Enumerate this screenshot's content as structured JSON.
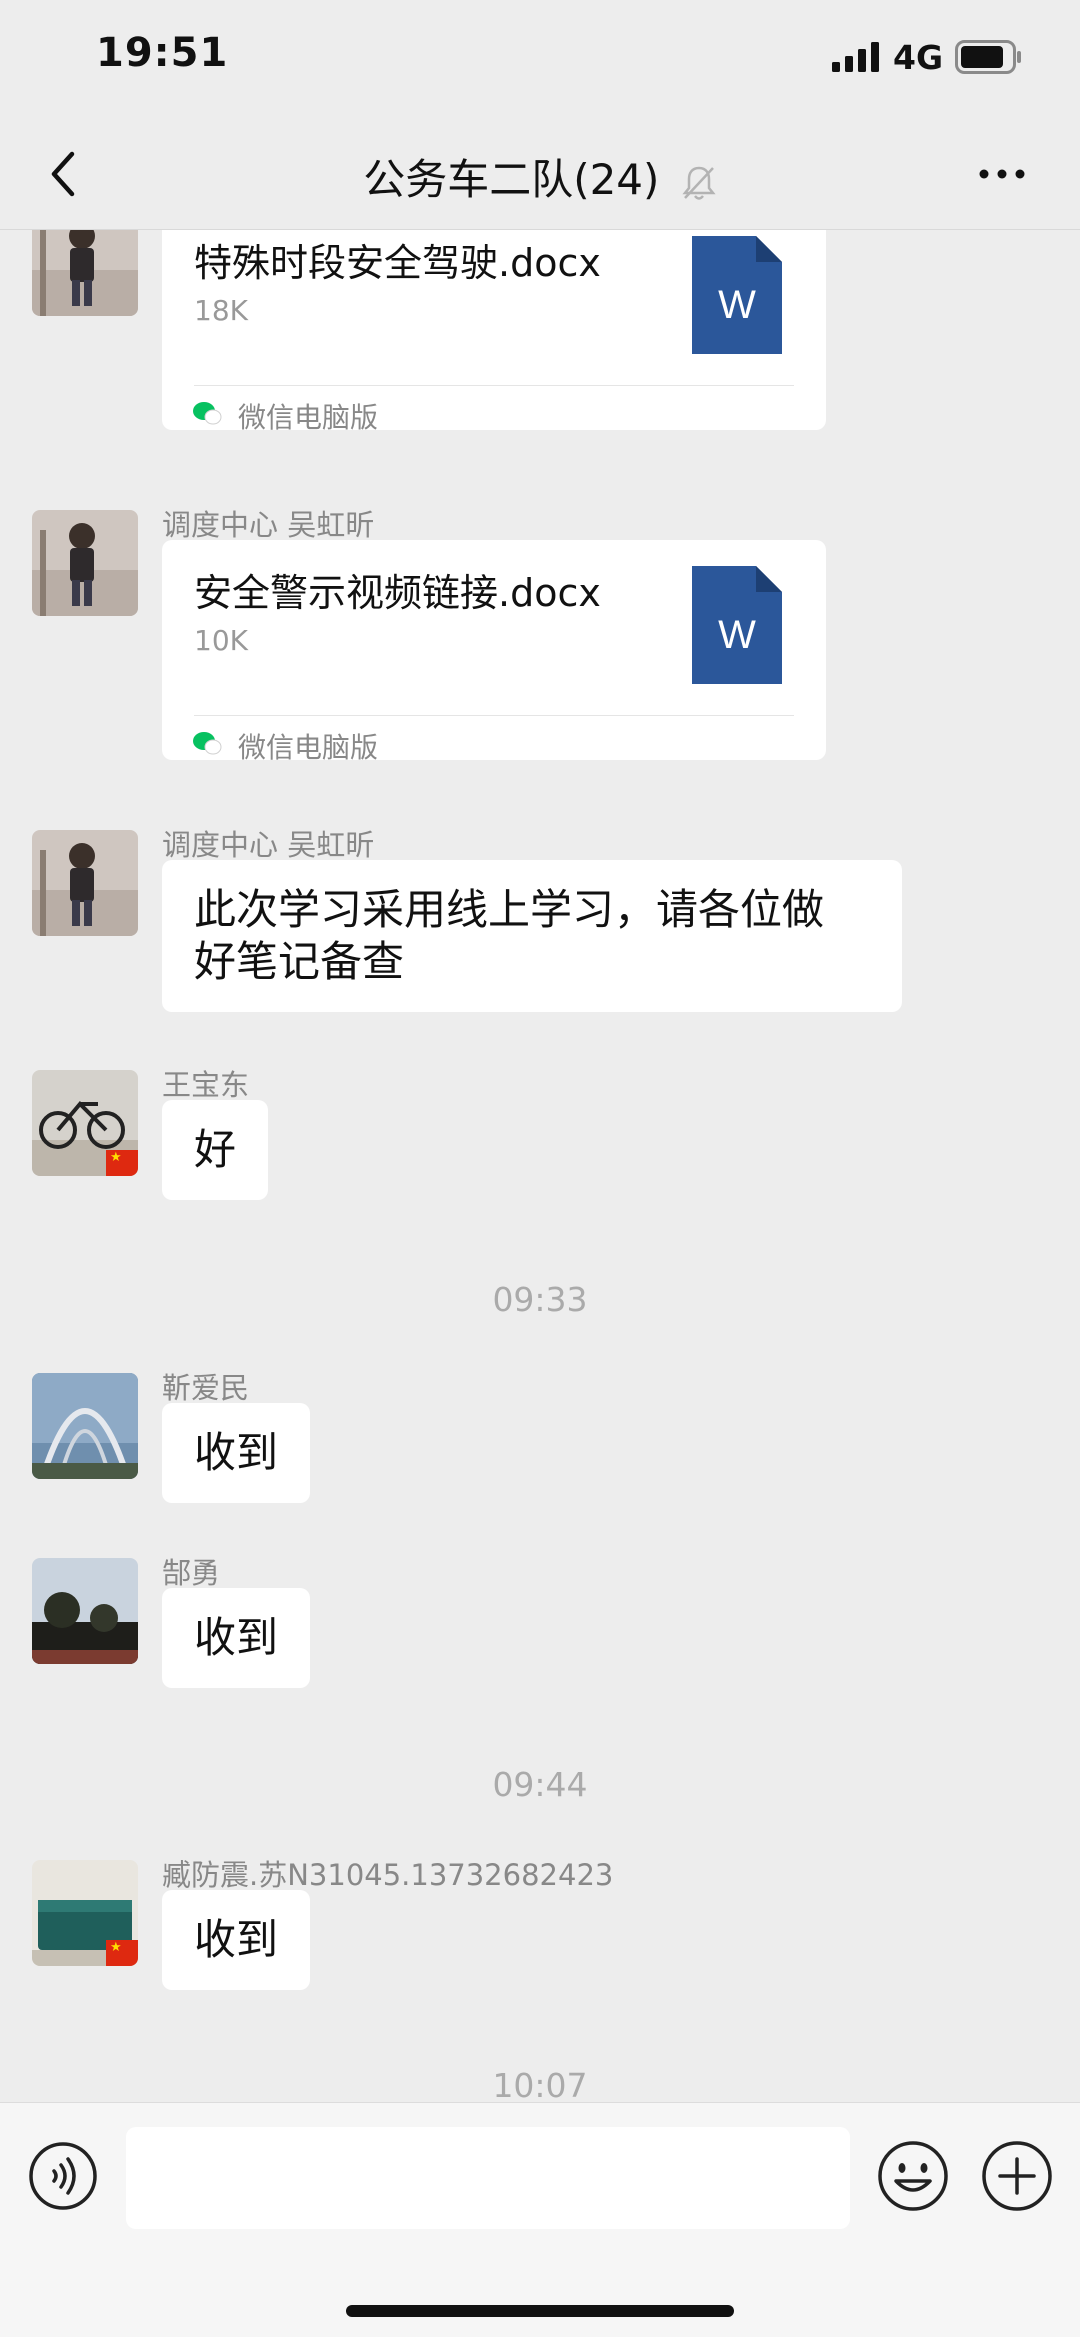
{
  "status_bar": {
    "time": "19:51",
    "network": "4G"
  },
  "header": {
    "title": "公务车二队(24)"
  },
  "messages": [
    {
      "type": "file",
      "file_name": "特殊时段安全驾驶.docx",
      "file_size": "18K",
      "source": "微信电脑版",
      "file_icon_letter": "W"
    },
    {
      "type": "file",
      "sender": "调度中心 吴虹昕",
      "file_name": "安全警示视频链接.docx",
      "file_size": "10K",
      "source": "微信电脑版",
      "file_icon_letter": "W"
    },
    {
      "type": "text",
      "sender": "调度中心 吴虹昕",
      "text_line1": "此次学习采用线上学习，请各位做",
      "text_line2": "好笔记备查"
    },
    {
      "type": "text",
      "sender": "王宝东",
      "text": "好"
    },
    {
      "type": "time",
      "text": "09:33"
    },
    {
      "type": "text",
      "sender": "靳爱民",
      "text": "收到"
    },
    {
      "type": "text",
      "sender": "郜勇",
      "text": "收到"
    },
    {
      "type": "time",
      "text": "09:44"
    },
    {
      "type": "text",
      "sender": "臧防震.苏N31045.13732682423",
      "text": "收到"
    },
    {
      "type": "time",
      "text": "10:07"
    }
  ],
  "input_bar": {
    "placeholder": ""
  },
  "colors": {
    "background": "#ededed",
    "bubble": "#ffffff",
    "word_blue": "#2b579a",
    "wechat_green": "#07c160"
  },
  "icons": [
    "signal-icon",
    "battery-icon",
    "back-icon",
    "mute-icon",
    "more-icon",
    "word-icon",
    "wechat-icon",
    "voice-icon",
    "emoji-icon",
    "plus-icon"
  ]
}
